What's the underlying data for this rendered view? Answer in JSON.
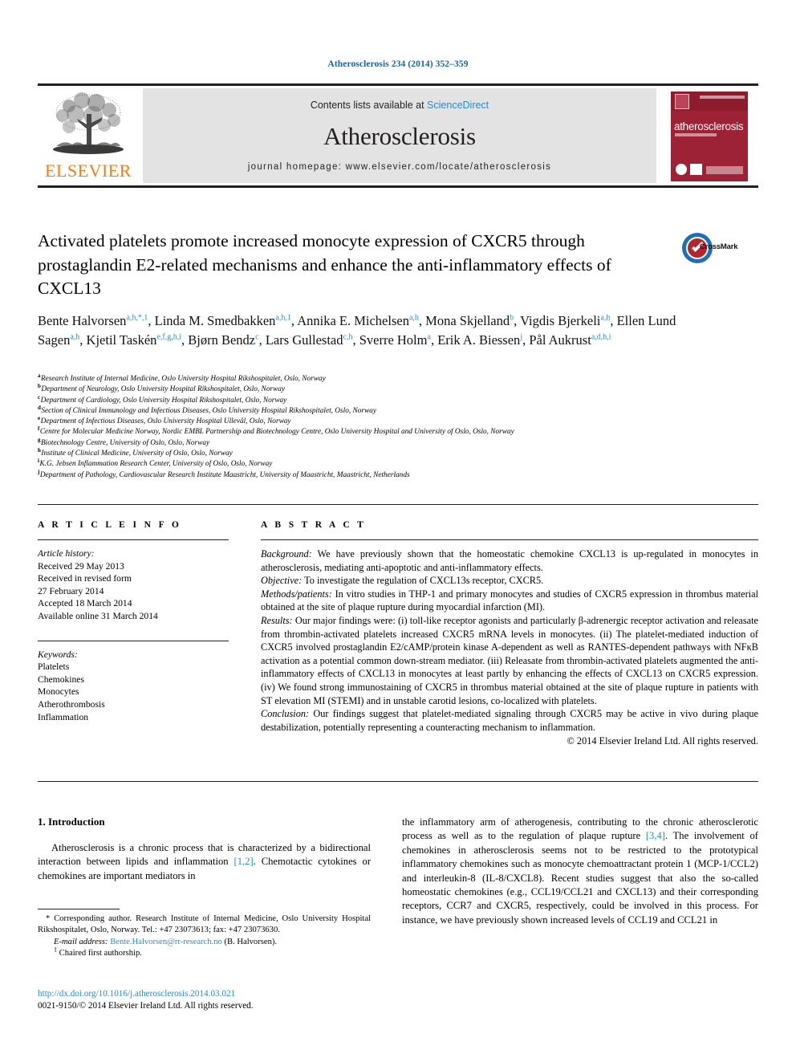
{
  "running_head": "Atherosclerosis 234 (2014) 352–359",
  "masthead": {
    "contents_prefix": "Contents lists available at ",
    "sciencedirect": "ScienceDirect",
    "journal_name": "Atherosclerosis",
    "homepage": "journal homepage: www.elsevier.com/locate/atherosclerosis",
    "publisher_wordmark": "ELSEVIER",
    "cover_title": "atherosclerosis"
  },
  "article": {
    "title": "Activated platelets promote increased monocyte expression of CXCR5 through prostaglandin E2-related mechanisms and enhance the anti-inflammatory effects of CXCL13",
    "crossmark_label": "CrossMark"
  },
  "authors": [
    {
      "name": "Bente Halvorsen",
      "marks": "a,h,*,1",
      "sep": ", "
    },
    {
      "name": "Linda M. Smedbakken",
      "marks": "a,h,1",
      "sep": ", "
    },
    {
      "name": "Annika E. Michelsen",
      "marks": "a,h",
      "sep": ", "
    },
    {
      "name": "Mona Skjelland",
      "marks": "b",
      "sep": ", "
    },
    {
      "name": "Vigdis Bjerkeli",
      "marks": "a,h",
      "sep": ", "
    },
    {
      "name": "Ellen Lund Sagen",
      "marks": "a,h",
      "sep": ", "
    },
    {
      "name": "Kjetil Taskén",
      "marks": "e,f,g,h,i",
      "sep": ", "
    },
    {
      "name": "Bjørn Bendz",
      "marks": "c",
      "sep": ", "
    },
    {
      "name": "Lars Gullestad",
      "marks": "c,h",
      "sep": ", "
    },
    {
      "name": "Sverre Holm",
      "marks": "a",
      "sep": ", "
    },
    {
      "name": "Erik A. Biessen",
      "marks": "j",
      "sep": ", "
    },
    {
      "name": "Pål Aukrust",
      "marks": "a,d,h,i",
      "sep": ""
    }
  ],
  "affiliations": [
    {
      "mark": "a",
      "text": "Research Institute of Internal Medicine, Oslo University Hospital Rikshospitalet, Oslo, Norway"
    },
    {
      "mark": "b",
      "text": "Department of Neurology, Oslo University Hospital Rikshospitalet, Oslo, Norway"
    },
    {
      "mark": "c",
      "text": "Department of Cardiology, Oslo University Hospital Rikshospitalet, Oslo, Norway"
    },
    {
      "mark": "d",
      "text": "Section of Clinical Immunology and Infectious Diseases, Oslo University Hospital Rikshospitalet, Oslo, Norway"
    },
    {
      "mark": "e",
      "text": "Department of Infectious Diseases, Oslo University Hospital Ullevål, Oslo, Norway"
    },
    {
      "mark": "f",
      "text": "Centre for Molecular Medicine Norway, Nordic EMBL Partnership and Biotechnology Centre, Oslo University Hospital and University of Oslo, Oslo, Norway"
    },
    {
      "mark": "g",
      "text": "Biotechnology Centre, University of Oslo, Oslo, Norway"
    },
    {
      "mark": "h",
      "text": "Institute of Clinical Medicine, University of Oslo, Oslo, Norway"
    },
    {
      "mark": "i",
      "text": "K.G. Jebsen Inflammation Research Center, University of Oslo, Oslo, Norway"
    },
    {
      "mark": "j",
      "text": "Department of Pathology, Cardiovascular Research Institute Maastricht, University of Maastricht, Maastricht, Netherlands"
    }
  ],
  "article_info": {
    "heading": "A R T I C L E   I N F O",
    "history_label": "Article history:",
    "history": [
      "Received 29 May 2013",
      "Received in revised form",
      "27 February 2014",
      "Accepted 18 March 2014",
      "Available online 31 March 2014"
    ],
    "keywords_label": "Keywords:",
    "keywords": [
      "Platelets",
      "Chemokines",
      "Monocytes",
      "Atherothrombosis",
      "Inflammation"
    ]
  },
  "abstract": {
    "heading": "A B S T R A C T",
    "sections": [
      {
        "label": "Background:",
        "text": " We have previously shown that the homeostatic chemokine CXCL13 is up-regulated in monocytes in atherosclerosis, mediating anti-apoptotic and anti-inflammatory effects."
      },
      {
        "label": "Objective:",
        "text": " To investigate the regulation of CXCL13s receptor, CXCR5."
      },
      {
        "label": "Methods/patients:",
        "text": " In vitro studies in THP-1 and primary monocytes and studies of CXCR5 expression in thrombus material obtained at the site of plaque rupture during myocardial infarction (MI)."
      },
      {
        "label": "Results:",
        "text": " Our major findings were: (i) toll-like receptor agonists and particularly β-adrenergic receptor activation and releasate from thrombin-activated platelets increased CXCR5 mRNA levels in monocytes. (ii) The platelet-mediated induction of CXCR5 involved prostaglandin E2/cAMP/protein kinase A-dependent as well as RANTES-dependent pathways with NFκB activation as a potential common down-stream mediator. (iii) Releasate from thrombin-activated platelets augmented the anti-inflammatory effects of CXCL13 in monocytes at least partly by enhancing the effects of CXCL13 on CXCR5 expression. (iv) We found strong immunostaining of CXCR5 in thrombus material obtained at the site of plaque rupture in patients with ST elevation MI (STEMI) and in unstable carotid lesions, co-localized with platelets."
      },
      {
        "label": "Conclusion:",
        "text": " Our findings suggest that platelet-mediated signaling through CXCR5 may be active in vivo during plaque destabilization, potentially representing a counteracting mechanism to inflammation."
      }
    ],
    "copyright": "© 2014 Elsevier Ireland Ltd. All rights reserved."
  },
  "body": {
    "intro_heading": "1. Introduction",
    "left_paragraph_a": "Atherosclerosis is a chronic process that is characterized by a bidirectional interaction between lipids and inflammation ",
    "left_citation_1": "[1,2]",
    "left_paragraph_b": ". Chemotactic cytokines or chemokines are important mediators in",
    "right_paragraph_a": "the inflammatory arm of atherogenesis, contributing to the chronic atherosclerotic process as well as to the regulation of plaque rupture ",
    "right_citation_1": "[3,4]",
    "right_paragraph_b": ". The involvement of chemokines in atherosclerosis seems not to be restricted to the prototypical inflammatory chemokines such as monocyte chemoattractant protein 1 (MCP-1/CCL2) and interleukin-8 (IL-8/CXCL8). Recent studies suggest that also the so-called homeostatic chemokines (e.g., CCL19/CCL21 and CXCL13) and their corresponding receptors, CCR7 and CXCR5, respectively, could be involved in this process. For instance, we have previously shown increased levels of CCL19 and CCL21 in"
  },
  "footnotes": {
    "corresponding": "* Corresponding author. Research Institute of Internal Medicine, Oslo University Hospital Rikshospitalet, Oslo, Norway. Tel.: +47 23073613; fax: +47 23073630.",
    "email_label": "E-mail address:",
    "email": "Bente.Halvorsen@rr-research.no",
    "email_owner": "(B. Halvorsen).",
    "footnote_1_marker": "1",
    "footnote_1": "Chaired first authorship.",
    "doi": "http://dx.doi.org/10.1016/j.atherosclerosis.2014.03.021",
    "issn_line": "0021-9150/© 2014 Elsevier Ireland Ltd. All rights reserved."
  },
  "colors": {
    "link_blue": "#2a8cc4",
    "elsevier_orange": "#f07f13",
    "cover_red": "#9d2235",
    "rule_black": "#231f20"
  }
}
